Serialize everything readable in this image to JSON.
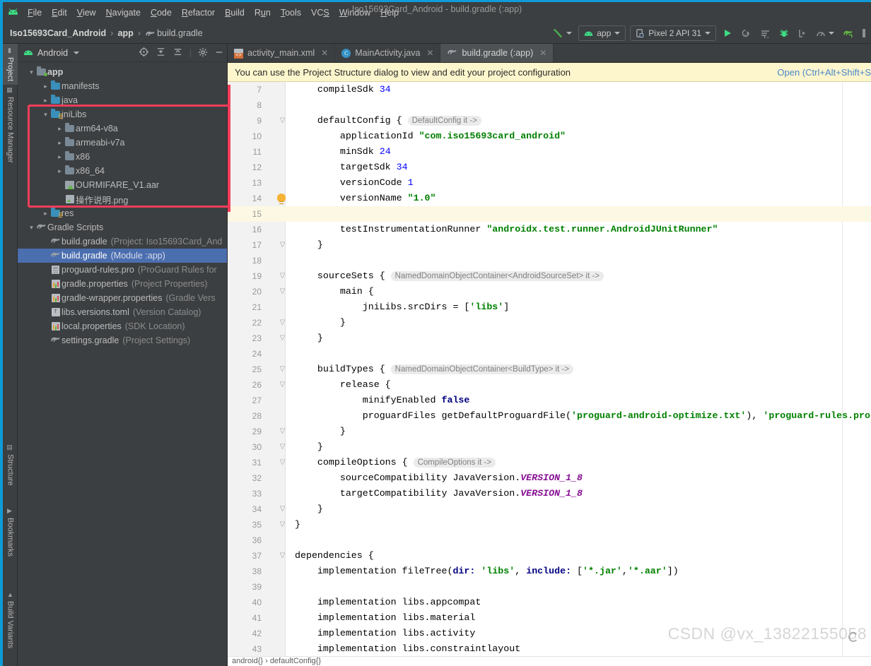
{
  "window": {
    "title": "Iso15693Card_Android - build.gradle (:app)"
  },
  "menu": {
    "items": [
      "File",
      "Edit",
      "View",
      "Navigate",
      "Code",
      "Refactor",
      "Build",
      "Run",
      "Tools",
      "VCS",
      "Window",
      "Help"
    ]
  },
  "navbar": {
    "crumb_project": "Iso15693Card_Android",
    "crumb_module": "app",
    "crumb_file": "build.gradle",
    "sep": "›",
    "run_config": "app",
    "device": "Pixel 2 API 31"
  },
  "left_tabs": [
    {
      "label": "Project",
      "icon": "project-icon",
      "selected": true
    },
    {
      "label": "Resource Manager",
      "icon": "resource-manager-icon",
      "selected": false
    }
  ],
  "left_tabs_bottom": [
    {
      "label": "Structure",
      "icon": "structure-icon"
    },
    {
      "label": "Bookmarks",
      "icon": "bookmarks-icon"
    },
    {
      "label": "Build Variants",
      "icon": "build-variants-icon"
    }
  ],
  "project_panel": {
    "title": "Android",
    "tree": [
      {
        "indent": 0,
        "arrow": "open",
        "icon": "folder-module",
        "label": "app",
        "hint": "",
        "bold": true,
        "selected": false
      },
      {
        "indent": 1,
        "arrow": "closed",
        "icon": "folder-blue",
        "label": "manifests",
        "hint": "",
        "bold": false,
        "selected": false
      },
      {
        "indent": 1,
        "arrow": "closed",
        "icon": "folder-blue",
        "label": "java",
        "hint": "",
        "bold": false,
        "selected": false
      },
      {
        "indent": 1,
        "arrow": "open",
        "icon": "folder-jni",
        "label": "jniLibs",
        "hint": "",
        "bold": false,
        "selected": false
      },
      {
        "indent": 2,
        "arrow": "closed",
        "icon": "folder-gray",
        "label": "arm64-v8a",
        "hint": "",
        "bold": false,
        "selected": false
      },
      {
        "indent": 2,
        "arrow": "closed",
        "icon": "folder-gray",
        "label": "armeabi-v7a",
        "hint": "",
        "bold": false,
        "selected": false
      },
      {
        "indent": 2,
        "arrow": "closed",
        "icon": "folder-gray",
        "label": "x86",
        "hint": "",
        "bold": false,
        "selected": false
      },
      {
        "indent": 2,
        "arrow": "closed",
        "icon": "folder-gray",
        "label": "x86_64",
        "hint": "",
        "bold": false,
        "selected": false
      },
      {
        "indent": 2,
        "arrow": "none",
        "icon": "aar-file",
        "label": "OURMIFARE_V1.aar",
        "hint": "",
        "bold": false,
        "selected": false
      },
      {
        "indent": 2,
        "arrow": "none",
        "icon": "png-file",
        "label": "操作说明.png",
        "hint": "",
        "bold": false,
        "selected": false
      },
      {
        "indent": 1,
        "arrow": "closed",
        "icon": "folder-res",
        "label": "res",
        "hint": "",
        "bold": false,
        "selected": false
      },
      {
        "indent": 0,
        "arrow": "open",
        "icon": "gradle",
        "label": "Gradle Scripts",
        "hint": "",
        "bold": false,
        "selected": false
      },
      {
        "indent": 1,
        "arrow": "none",
        "icon": "gradle",
        "label": "build.gradle",
        "hint": "(Project: Iso15693Card_And",
        "bold": false,
        "selected": false
      },
      {
        "indent": 1,
        "arrow": "none",
        "icon": "gradle",
        "label": "build.gradle",
        "hint": "(Module :app)",
        "bold": false,
        "selected": true
      },
      {
        "indent": 1,
        "arrow": "none",
        "icon": "pro-file",
        "label": "proguard-rules.pro",
        "hint": "(ProGuard Rules for",
        "bold": false,
        "selected": false
      },
      {
        "indent": 1,
        "arrow": "none",
        "icon": "props-file",
        "label": "gradle.properties",
        "hint": "(Project Properties)",
        "bold": false,
        "selected": false
      },
      {
        "indent": 1,
        "arrow": "none",
        "icon": "props-file",
        "label": "gradle-wrapper.properties",
        "hint": "(Gradle Vers",
        "bold": false,
        "selected": false
      },
      {
        "indent": 1,
        "arrow": "none",
        "icon": "toml-file",
        "label": "libs.versions.toml",
        "hint": "(Version Catalog)",
        "bold": false,
        "selected": false
      },
      {
        "indent": 1,
        "arrow": "none",
        "icon": "props-file",
        "label": "local.properties",
        "hint": "(SDK Location)",
        "bold": false,
        "selected": false
      },
      {
        "indent": 1,
        "arrow": "none",
        "icon": "gradle",
        "label": "settings.gradle",
        "hint": "(Project Settings)",
        "bold": false,
        "selected": false
      }
    ]
  },
  "editor_tabs": [
    {
      "label": "activity_main.xml",
      "icon": "xml-file-icon",
      "active": false
    },
    {
      "label": "MainActivity.java",
      "icon": "java-class-icon",
      "active": false
    },
    {
      "label": "build.gradle (:app)",
      "icon": "gradle-icon",
      "active": true
    }
  ],
  "notification": {
    "text": "You can use the Project Structure dialog to view and edit your project configuration",
    "action": "Open (Ctrl+Alt+Shift+S"
  },
  "code": {
    "first_line": 7,
    "lines": [
      {
        "n": 7,
        "fold": "",
        "bulb": false,
        "hl": false,
        "html": "    <span class='fn'>compileSdk</span> <span class='num2'>34</span>"
      },
      {
        "n": 8,
        "fold": "",
        "bulb": false,
        "hl": false,
        "html": ""
      },
      {
        "n": 9,
        "fold": "-",
        "bulb": false,
        "hl": false,
        "html": "    <span class='fn'>defaultConfig</span> { <span class='inlay'>DefaultConfig it -&gt;</span>"
      },
      {
        "n": 10,
        "fold": "",
        "bulb": false,
        "hl": false,
        "html": "        <span class='fn'>applicationId</span> <span class='str'>\"com.iso15693card_android\"</span>"
      },
      {
        "n": 11,
        "fold": "",
        "bulb": false,
        "hl": false,
        "html": "        <span class='fn'>minSdk</span> <span class='num2'>24</span>"
      },
      {
        "n": 12,
        "fold": "",
        "bulb": false,
        "hl": false,
        "html": "        <span class='fn'>targetSdk</span> <span class='num2'>34</span>"
      },
      {
        "n": 13,
        "fold": "",
        "bulb": false,
        "hl": false,
        "html": "        <span class='fn'>versionCode</span> <span class='num2'>1</span>"
      },
      {
        "n": 14,
        "fold": "",
        "bulb": true,
        "hl": false,
        "html": "        <span class='fn'>versionName</span> <span class='str'>\"1.0\"</span>"
      },
      {
        "n": 15,
        "fold": "",
        "bulb": false,
        "hl": true,
        "html": ""
      },
      {
        "n": 16,
        "fold": "",
        "bulb": false,
        "hl": false,
        "html": "        <span class='fn'>testInstrumentationRunner</span> <span class='str'>\"androidx.test.runner.AndroidJUnitRunner\"</span>"
      },
      {
        "n": 17,
        "fold": "-",
        "bulb": false,
        "hl": false,
        "html": "    }"
      },
      {
        "n": 18,
        "fold": "",
        "bulb": false,
        "hl": false,
        "html": ""
      },
      {
        "n": 19,
        "fold": "-",
        "bulb": false,
        "hl": false,
        "html": "    <span class='fn'>sourceSets</span> { <span class='inlay'>NamedDomainObjectContainer&lt;AndroidSourceSet&gt; it -&gt;</span>"
      },
      {
        "n": 20,
        "fold": "-",
        "bulb": false,
        "hl": false,
        "html": "        <span class='fn'>main</span> {"
      },
      {
        "n": 21,
        "fold": "",
        "bulb": false,
        "hl": false,
        "html": "            <span class='fn'>jniLibs.srcDirs</span> = [<span class='str'>'libs'</span>]"
      },
      {
        "n": 22,
        "fold": "-",
        "bulb": false,
        "hl": false,
        "html": "        }"
      },
      {
        "n": 23,
        "fold": "-",
        "bulb": false,
        "hl": false,
        "html": "    }"
      },
      {
        "n": 24,
        "fold": "",
        "bulb": false,
        "hl": false,
        "html": ""
      },
      {
        "n": 25,
        "fold": "-",
        "bulb": false,
        "hl": false,
        "html": "    <span class='fn'>buildTypes</span> { <span class='inlay'>NamedDomainObjectContainer&lt;BuildType&gt; it -&gt;</span>"
      },
      {
        "n": 26,
        "fold": "-",
        "bulb": false,
        "hl": false,
        "html": "        <span class='fn'>release</span> {"
      },
      {
        "n": 27,
        "fold": "",
        "bulb": false,
        "hl": false,
        "html": "            <span class='fn'>minifyEnabled</span> <span class='k'>false</span>"
      },
      {
        "n": 28,
        "fold": "",
        "bulb": false,
        "hl": false,
        "html": "            <span class='fn'>proguardFiles</span> <span class='fn'>getDefaultProguardFile</span>(<span class='str'>'proguard-android-optimize.txt'</span>), <span class='str'>'proguard-rules.pro'</span>"
      },
      {
        "n": 29,
        "fold": "-",
        "bulb": false,
        "hl": false,
        "html": "        }"
      },
      {
        "n": 30,
        "fold": "-",
        "bulb": false,
        "hl": false,
        "html": "    }"
      },
      {
        "n": 31,
        "fold": "-",
        "bulb": false,
        "hl": false,
        "html": "    <span class='fn'>compileOptions</span> { <span class='inlay'>CompileOptions it -&gt;</span>"
      },
      {
        "n": 32,
        "fold": "",
        "bulb": false,
        "hl": false,
        "html": "        <span class='fn'>sourceCompatibility</span> <span class='fn'>JavaVersion.</span><span class='ital'>VERSION_1_8</span>"
      },
      {
        "n": 33,
        "fold": "",
        "bulb": false,
        "hl": false,
        "html": "        <span class='fn'>targetCompatibility</span> <span class='fn'>JavaVersion.</span><span class='ital'>VERSION_1_8</span>"
      },
      {
        "n": 34,
        "fold": "-",
        "bulb": false,
        "hl": false,
        "html": "    }"
      },
      {
        "n": 35,
        "fold": "-",
        "bulb": false,
        "hl": false,
        "html": "}"
      },
      {
        "n": 36,
        "fold": "",
        "bulb": false,
        "hl": false,
        "html": ""
      },
      {
        "n": 37,
        "fold": "-",
        "bulb": false,
        "hl": false,
        "html": "<span class='fn'>dependencies</span> {"
      },
      {
        "n": 38,
        "fold": "",
        "bulb": false,
        "hl": false,
        "html": "    <span class='fn'>implementation</span> <span class='fn'>fileTree</span>(<span class='k'>dir:</span> <span class='str'>'libs'</span>, <span class='k'>include:</span> [<span class='str'>'*.jar'</span>,<span class='str'>'*.aar'</span>])"
      },
      {
        "n": 39,
        "fold": "",
        "bulb": false,
        "hl": false,
        "html": ""
      },
      {
        "n": 40,
        "fold": "",
        "bulb": false,
        "hl": false,
        "html": "    <span class='fn'>implementation</span> <span class='fn'>libs.appcompat</span>"
      },
      {
        "n": 41,
        "fold": "",
        "bulb": false,
        "hl": false,
        "html": "    <span class='fn'>implementation</span> <span class='fn'>libs.material</span>"
      },
      {
        "n": 42,
        "fold": "",
        "bulb": false,
        "hl": false,
        "html": "    <span class='fn'>implementation</span> <span class='fn'>libs.activity</span>"
      },
      {
        "n": 43,
        "fold": "",
        "bulb": false,
        "hl": false,
        "html": "    <span class='fn'>implementation</span> <span class='fn'>libs.constraintlayout</span>"
      }
    ]
  },
  "status": {
    "breadcrumb": "android{}  ›  defaultConfig{}"
  },
  "watermark": "CSDN @vx_13822155058",
  "colors": {
    "chrome": "#3c3f41",
    "accent_blue": "#0f9bd8",
    "selection": "#4b6eaf",
    "highlight_box": "#f43d5a",
    "notif_bg": "#fdf6cd",
    "string_green": "#008000",
    "keyword_navy": "#000080",
    "number_blue": "#0000ff",
    "android_green": "#3ddc84"
  }
}
